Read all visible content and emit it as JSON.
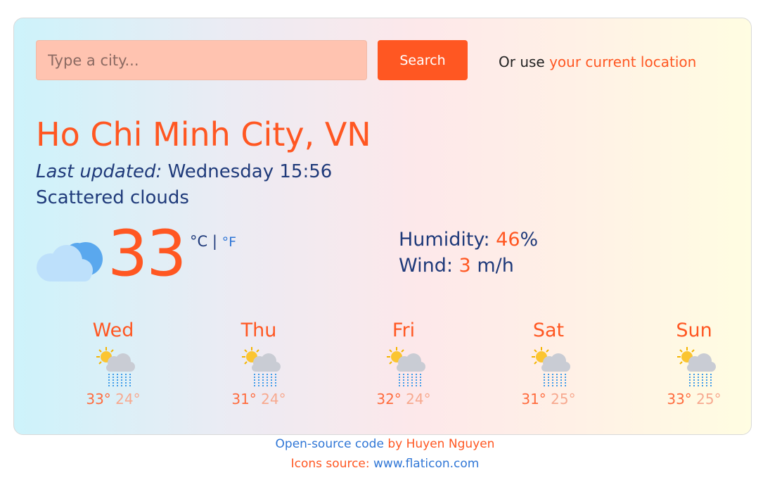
{
  "search": {
    "placeholder": "Type a city...",
    "button_label": "Search",
    "location_prefix": "Or use",
    "location_link": "your current location"
  },
  "current": {
    "city": "Ho Chi Minh City, VN",
    "updated_label": "Last updated:",
    "updated_value": "Wednesday 15:56",
    "description": "Scattered clouds",
    "icon": "cloud-icon",
    "temperature": "33",
    "unit_c": "°C",
    "unit_sep": "|",
    "unit_f": "°F",
    "humidity_label": "Humidity:",
    "humidity_value": "46",
    "humidity_unit": "%",
    "wind_label": "Wind:",
    "wind_value": "3",
    "wind_unit": "m/h"
  },
  "forecast": [
    {
      "day": "Wed",
      "max": "33°",
      "min": "24°",
      "icon": "sun-cloud-rain-icon"
    },
    {
      "day": "Thu",
      "max": "31°",
      "min": "24°",
      "icon": "sun-cloud-rain-icon"
    },
    {
      "day": "Fri",
      "max": "32°",
      "min": "24°",
      "icon": "sun-cloud-rain-icon"
    },
    {
      "day": "Sat",
      "max": "31°",
      "min": "25°",
      "icon": "sun-cloud-rain-icon"
    },
    {
      "day": "Sun",
      "max": "33°",
      "min": "25°",
      "icon": "sun-cloud-rain-icon"
    }
  ],
  "footer": {
    "code_link": "Open-source code",
    "code_by": "by",
    "author": "Huyen Nguyen",
    "icons_label": "Icons source:",
    "icons_link": "www.flaticon.com"
  },
  "colors": {
    "accent": "#ff5722",
    "text_primary": "#1f3a7a",
    "link_blue": "#2f76d6",
    "input_bg": "#ffc3b0"
  }
}
